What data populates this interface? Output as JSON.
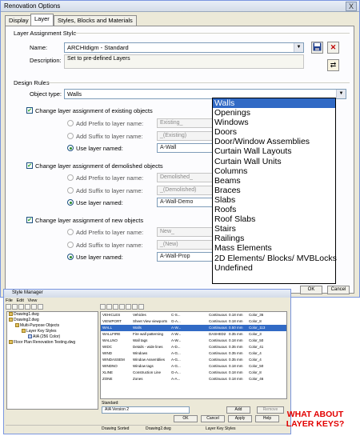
{
  "window": {
    "title": "Renovation Options",
    "close": "X"
  },
  "tabs": [
    "Display",
    "Layer",
    "Styles, Blocks and Materials"
  ],
  "layer_assignment": {
    "group_title": "Layer Assignment Style",
    "name_label": "Name:",
    "name_value": "ARCHIdigm - Standard",
    "description_label": "Description:",
    "description_value": "Set to pre-defined Layers"
  },
  "design_rules": {
    "group_title": "Design Rules",
    "object_type_label": "Object type:",
    "object_type_value": "Walls"
  },
  "sections": [
    {
      "checkbox_label": "Change layer assignment of existing objects",
      "prefix_label": "Add Prefix to layer name:",
      "prefix_value": "Existing_",
      "suffix_label": "Add Suffix to layer name:",
      "suffix_value": "_(Existing)",
      "use_label": "Use layer named:",
      "use_value": "A-Wall"
    },
    {
      "checkbox_label": "Change layer assignment of demolished objects",
      "prefix_label": "Add Prefix to layer name:",
      "prefix_value": "Demolished_",
      "suffix_label": "Add Suffix to layer name:",
      "suffix_value": "_(Demolished)",
      "use_label": "Use layer named:",
      "use_value": "A-Wall-Demo"
    },
    {
      "checkbox_label": "Change layer assignment of new objects",
      "prefix_label": "Add Prefix to layer name:",
      "prefix_value": "New_",
      "suffix_label": "Add Suffix to layer name:",
      "suffix_value": "_(New)",
      "use_label": "Use layer named:",
      "use_value": "A-Wall-Prop"
    }
  ],
  "dropdown_items": [
    "Walls",
    "Openings",
    "Windows",
    "Doors",
    "Door/Window Assemblies",
    "Curtain Wall Layouts",
    "Curtain Wall Units",
    "Columns",
    "Beams",
    "Braces",
    "Slabs",
    "Roofs",
    "Roof Slabs",
    "Stairs",
    "Railings",
    "Mass Elements",
    "2D Elements/ Blocks/ MVBLocks",
    "Undefined"
  ],
  "dialog_buttons": {
    "ok": "OK",
    "cancel": "Cancel"
  },
  "style_manager": {
    "title": "Style Manager",
    "menu": [
      "File",
      "Edit",
      "View"
    ],
    "tree": [
      {
        "label": "Drawing1.dwg"
      },
      {
        "label": "Drawing2.dwg"
      },
      {
        "label": "Multi-Purpose Objects"
      },
      {
        "label": "Layer Key Styles"
      },
      {
        "label": "AIA (256 Color)"
      },
      {
        "label": "Floor Plan Renovation Testing.dwg"
      }
    ],
    "rows": [
      {
        "key": "VEHICLES",
        "desc": "Vehicles",
        "ls": "C-S...",
        "line": "Continuous",
        "w": "0.18 mm",
        "color": "Color_36"
      },
      {
        "key": "VIEWPORT",
        "desc": "Sheet View viewports",
        "ls": "G-A...",
        "line": "Continuous",
        "w": "0.18 mm",
        "color": "Color_8"
      },
      {
        "key": "WALL",
        "desc": "Walls",
        "ls": "A-W...",
        "line": "Continuous",
        "w": "0.50 mm",
        "color": "Color_113"
      },
      {
        "key": "WALLFIRE",
        "desc": "Fire wall patterning",
        "ls": "A-W...",
        "line": "DASHED2",
        "w": "0.35 mm",
        "color": "Color_3"
      },
      {
        "key": "WALLNO",
        "desc": "Wall tags",
        "ls": "A-W...",
        "line": "Continuous",
        "w": "0.18 mm",
        "color": "Color_50"
      },
      {
        "key": "WIDC",
        "desc": "Details - wide lines",
        "ls": "A-D...",
        "line": "Continuous",
        "w": "0.35 mm",
        "color": "Color_41"
      },
      {
        "key": "WIND",
        "desc": "Windows",
        "ls": "A-G...",
        "line": "Continuous",
        "w": "0.35 mm",
        "color": "Color_4"
      },
      {
        "key": "WINDASSEM",
        "desc": "Window Assemblies",
        "ls": "A-G...",
        "line": "Continuous",
        "w": "0.35 mm",
        "color": "Color_4"
      },
      {
        "key": "WINDNO",
        "desc": "Window tags",
        "ls": "A-G...",
        "line": "Continuous",
        "w": "0.18 mm",
        "color": "Color_50"
      },
      {
        "key": "XLINE",
        "desc": "Construction Line",
        "ls": "G-A...",
        "line": "Continuous",
        "w": "0.18 mm",
        "color": "Color_8"
      },
      {
        "key": "ZONE",
        "desc": "Zones",
        "ls": "A-A...",
        "line": "Continuous",
        "w": "0.18 mm",
        "color": "Color_46"
      }
    ],
    "standard_label": "Standard:",
    "standard_value": "AIA Version 2",
    "add": "Add",
    "remove": "Remove",
    "buttons": [
      "OK",
      "Cancel",
      "Apply",
      "Help"
    ],
    "status": [
      "Drawing Sorted",
      "Drawing2.dwg",
      "Layer Key Styles"
    ]
  },
  "callout": "WHAT ABOUT LAYER KEYS?",
  "colors": {
    "selection": "#316ac5",
    "callout": "#e20000",
    "dialog_bg": "#ece9d8"
  }
}
